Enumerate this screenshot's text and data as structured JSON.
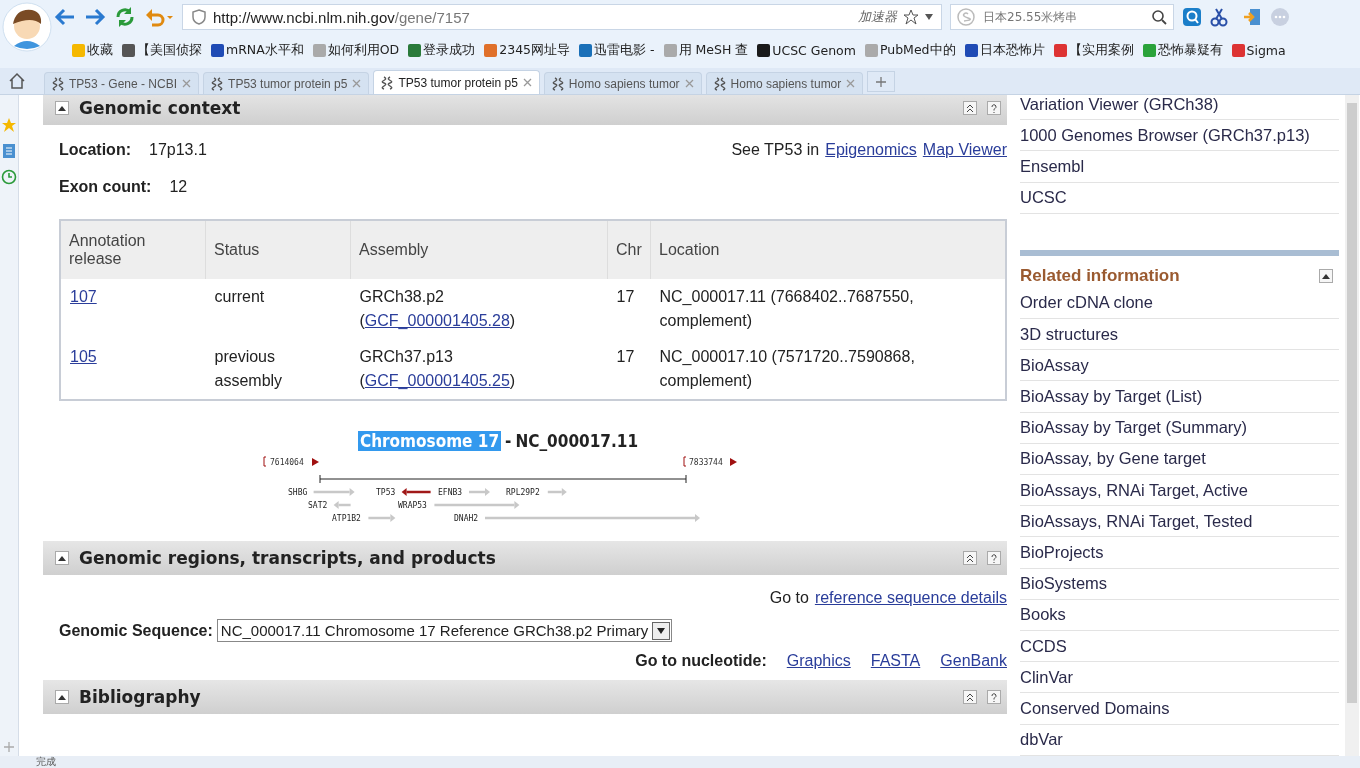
{
  "browser": {
    "url_host": "http://www.ncbi.nlm.nih.gov",
    "url_path": "/gene/7157",
    "accelerator": "加速器",
    "search_placeholder": "日本25.55米烤串",
    "bookmarks": [
      "收藏",
      "【美国侦探",
      "mRNA水平和",
      "如何利用OD",
      "登录成功",
      "2345网址导",
      "迅雷电影 -",
      "用 MeSH 查",
      "UCSC Genom",
      "PubMed中的",
      "日本恐怖片",
      "【实用案例",
      "恐怖暴疑有",
      "Sigma"
    ],
    "tabs": [
      {
        "label": "TP53 - Gene - NCBI",
        "selected": false
      },
      {
        "label": "TP53 tumor protein p5",
        "selected": false
      },
      {
        "label": "TP53 tumor protein p5",
        "selected": true
      },
      {
        "label": "Homo sapiens tumor",
        "selected": false
      },
      {
        "label": "Homo sapiens tumor",
        "selected": false
      }
    ],
    "status": "完成"
  },
  "sections": [
    {
      "title": "Genomic context",
      "expanded": true
    },
    {
      "title": "Genomic regions, transcripts, and products",
      "expanded": true
    },
    {
      "title": "Bibliography",
      "expanded": true
    }
  ],
  "context": {
    "location_label": "Location:",
    "location": "17p13.1",
    "exon_label": "Exon count:",
    "exon_count": "12",
    "see_prefix": "See TP53 in",
    "see_links": [
      "Epigenomics",
      "Map Viewer"
    ],
    "table": {
      "columns": [
        "Annotation release",
        "Status",
        "Assembly",
        "Chr",
        "Location"
      ],
      "rows": [
        {
          "release": "107",
          "status": "current",
          "assembly": "GRCh38.p2 (",
          "accession": "GCF_000001405.28",
          "assembly_end": ")",
          "chr": "17",
          "location": "NC_000017.11 (7668402..7687550, complement)"
        },
        {
          "release": "105",
          "status": "previous assembly",
          "assembly": "GRCh37.p13 (",
          "accession": "GCF_000001405.25",
          "assembly_end": ")",
          "chr": "17",
          "location": "NC_000017.10 (7571720..7590868, complement)"
        }
      ]
    }
  },
  "diagram": {
    "chromosome": "Chromosome 17",
    "separator": "-",
    "accession": "NC_000017.11",
    "start": "7614064",
    "end": "7833744",
    "genes": [
      {
        "name": "SHBG",
        "kind": "forward",
        "selected": false
      },
      {
        "name": "TP53",
        "kind": "reverse",
        "selected": true
      },
      {
        "name": "EFNB3",
        "kind": "forward",
        "selected": false
      },
      {
        "name": "RPL29P2",
        "kind": "forward",
        "selected": false
      },
      {
        "name": "SAT2",
        "kind": "reverse",
        "selected": false
      },
      {
        "name": "WRAP53",
        "kind": "forward",
        "selected": false
      },
      {
        "name": "ATP1B2",
        "kind": "forward",
        "selected": false
      },
      {
        "name": "DNAH2",
        "kind": "forward",
        "selected": false
      }
    ]
  },
  "regions": {
    "goto_prefix": "Go to",
    "goto_link": "reference sequence details",
    "sequence_label": "Genomic Sequence:",
    "sequence_value": "NC_000017.11 Chromosome 17 Reference GRCh38.p2 Primary",
    "nucleotide_label": "Go to nucleotide:",
    "nucleotide_links": [
      "Graphics",
      "FASTA",
      "GenBank"
    ]
  },
  "sidebar": {
    "top_links": [
      "Variation Viewer (GRCh38)",
      "1000 Genomes Browser (GRCh37.p13)",
      "Ensembl",
      "UCSC"
    ],
    "related_title": "Related information",
    "related_links": [
      "Order cDNA clone",
      "3D structures",
      "BioAssay",
      "BioAssay by Target (List)",
      "BioAssay by Target (Summary)",
      "BioAssay, by Gene target",
      "BioAssays, RNAi Target, Active",
      "BioAssays, RNAi Target, Tested",
      "BioProjects",
      "BioSystems",
      "Books",
      "CCDS",
      "ClinVar",
      "Conserved Domains",
      "dbVar"
    ]
  }
}
